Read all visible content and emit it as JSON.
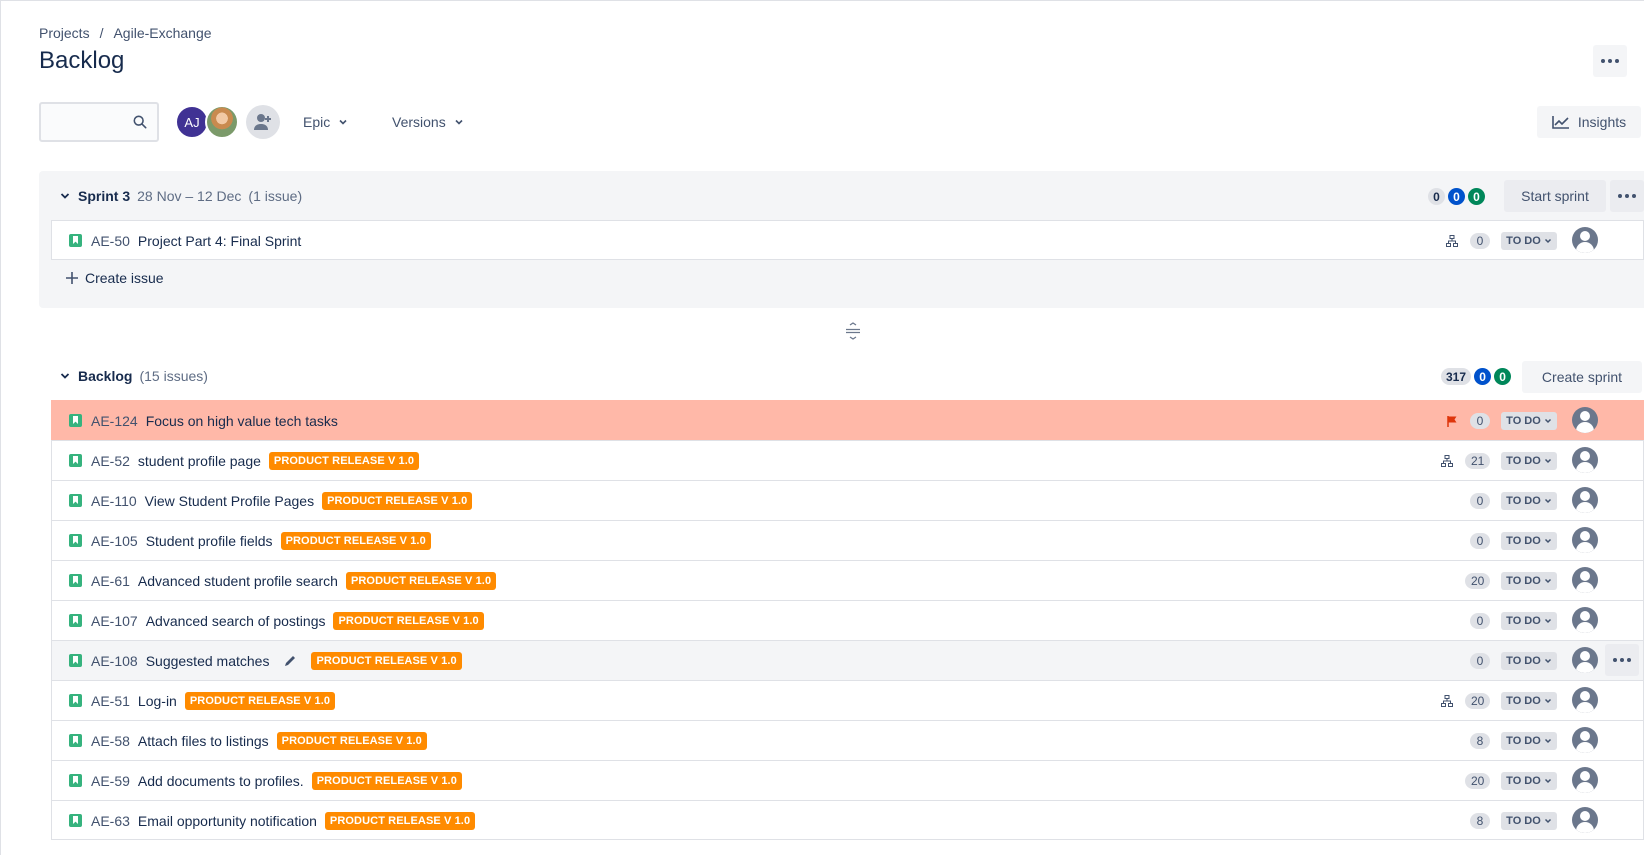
{
  "breadcrumb": {
    "projects": "Projects",
    "separator": "/",
    "project": "Agile-Exchange"
  },
  "page_title": "Backlog",
  "toolbar": {
    "search_placeholder": "",
    "avatar_initials": "AJ",
    "epic_label": "Epic",
    "versions_label": "Versions",
    "insights_label": "Insights"
  },
  "sprint": {
    "name": "Sprint 3",
    "dates": "28 Nov – 12 Dec",
    "issue_count": "(1 issue)",
    "counts": {
      "todo": "0",
      "in_progress": "0",
      "done": "0"
    },
    "start_button": "Start sprint",
    "issue": {
      "key": "AE-50",
      "summary": "Project Part 4: Final Sprint",
      "points": "0",
      "status": "TO DO"
    },
    "create_issue": "Create issue"
  },
  "backlog": {
    "name": "Backlog",
    "issue_count": "(15 issues)",
    "counts": {
      "todo": "317",
      "in_progress": "0",
      "done": "0"
    },
    "create_button": "Create sprint",
    "issues": [
      {
        "key": "AE-124",
        "summary": "Focus on high value tech tasks",
        "epic": "",
        "points": "0",
        "status": "TO DO",
        "flagged": true,
        "child_icon": false
      },
      {
        "key": "AE-52",
        "summary": "student profile page",
        "epic": "PRODUCT RELEASE V 1.0",
        "points": "21",
        "status": "TO DO",
        "flagged": false,
        "child_icon": true
      },
      {
        "key": "AE-110",
        "summary": "View Student Profile Pages",
        "epic": "PRODUCT RELEASE V 1.0",
        "points": "0",
        "status": "TO DO",
        "flagged": false,
        "child_icon": false
      },
      {
        "key": "AE-105",
        "summary": "Student profile fields",
        "epic": "PRODUCT RELEASE V 1.0",
        "points": "0",
        "status": "TO DO",
        "flagged": false,
        "child_icon": false
      },
      {
        "key": "AE-61",
        "summary": "Advanced student profile search",
        "epic": "PRODUCT RELEASE V 1.0",
        "points": "20",
        "status": "TO DO",
        "flagged": false,
        "child_icon": false
      },
      {
        "key": "AE-107",
        "summary": "Advanced search of postings",
        "epic": "PRODUCT RELEASE V 1.0",
        "points": "0",
        "status": "TO DO",
        "flagged": false,
        "child_icon": false
      },
      {
        "key": "AE-108",
        "summary": "Suggested matches",
        "epic": "PRODUCT RELEASE V 1.0",
        "points": "0",
        "status": "TO DO",
        "flagged": false,
        "child_icon": false,
        "hovered": true
      },
      {
        "key": "AE-51",
        "summary": "Log-in",
        "epic": "PRODUCT RELEASE V 1.0",
        "points": "20",
        "status": "TO DO",
        "flagged": false,
        "child_icon": true
      },
      {
        "key": "AE-58",
        "summary": "Attach files to listings",
        "epic": "PRODUCT RELEASE V 1.0",
        "points": "8",
        "status": "TO DO",
        "flagged": false,
        "child_icon": false
      },
      {
        "key": "AE-59",
        "summary": "Add documents to profiles.",
        "epic": "PRODUCT RELEASE V 1.0",
        "points": "20",
        "status": "TO DO",
        "flagged": false,
        "child_icon": false
      },
      {
        "key": "AE-63",
        "summary": "Email opportunity notification",
        "epic": "PRODUCT RELEASE V 1.0",
        "points": "8",
        "status": "TO DO",
        "flagged": false,
        "child_icon": false
      }
    ]
  },
  "colors": {
    "epic": "#ff8b00",
    "flag_row": "#ffb8a8",
    "story": "#36b37e",
    "blue": "#0052cc",
    "green": "#00875a"
  }
}
